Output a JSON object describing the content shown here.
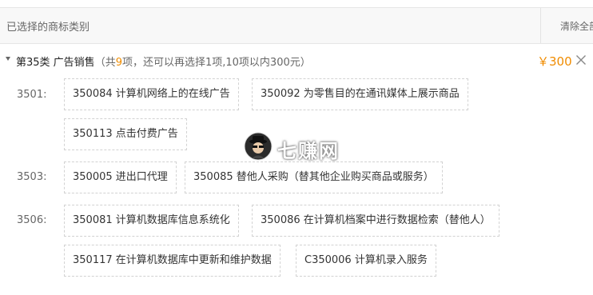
{
  "header": {
    "title": "已选择的商标类别",
    "clear_all": "清除全部"
  },
  "class_section": {
    "class_name": "第35类 广告销售",
    "summary_prefix": "（共",
    "selected_count": "9",
    "summary_suffix": "项，还可以再选择1项,10项以内300元）",
    "price": "￥300"
  },
  "groups": [
    {
      "code": "3501:",
      "items": [
        "350084 计算机网络上的在线广告",
        "350092 为零售目的在通讯媒体上展示商品",
        "350113 点击付费广告"
      ]
    },
    {
      "code": "3503:",
      "items": [
        "350005 进出口代理",
        "350085 替他人采购（替其他企业购买商品或服务）"
      ]
    },
    {
      "code": "3506:",
      "items": [
        "350081 计算机数据库信息系统化",
        "350086 在计算机档案中进行数据检索（替他人）",
        "350117 在计算机数据库中更新和维护数据",
        "C350006 计算机录入服务"
      ]
    }
  ],
  "watermark": {
    "text": "七赚网"
  },
  "colors": {
    "accent": "#f08c00",
    "border_dashed": "#d2d2d2",
    "header_bg": "#f8f8f8"
  },
  "icons": {
    "collapse": "caret-down-icon",
    "remove": "close-icon",
    "watermark": "avatar-icon"
  }
}
